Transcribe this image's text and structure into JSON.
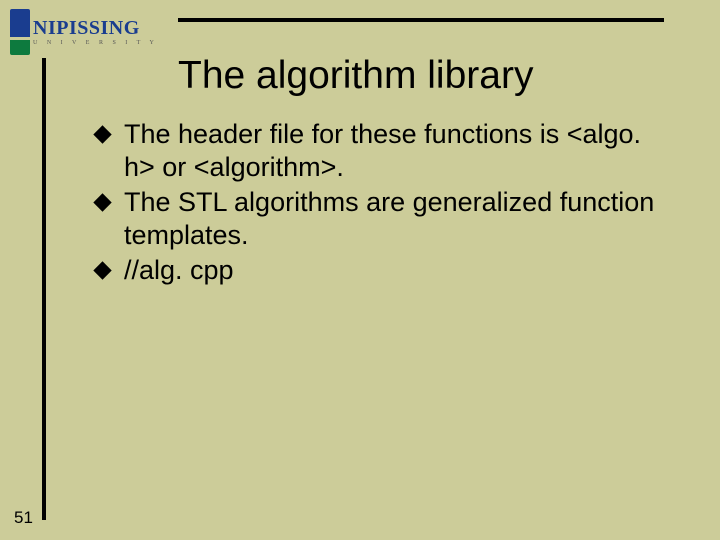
{
  "logo": {
    "name": "NIPISSING",
    "sub": "U N I V E R S I T Y"
  },
  "title": "The algorithm library",
  "bullets": [
    "The header file for these functions is <algo. h> or <algorithm>.",
    "The STL algorithms are generalized function templates.",
    "//alg. cpp"
  ],
  "page_number": "51"
}
